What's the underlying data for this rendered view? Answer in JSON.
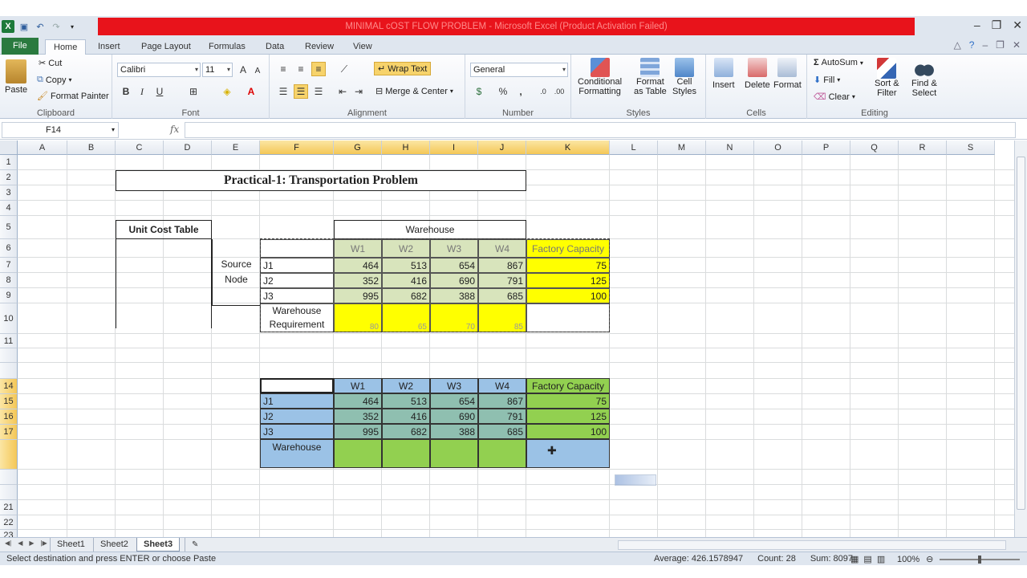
{
  "window": {
    "title": "MINIMAL cOST FLOW PROBLEM  -  Microsoft Excel (Product Activation Failed)"
  },
  "ribbon_tabs": [
    "File",
    "Home",
    "Insert",
    "Page Layout",
    "Formulas",
    "Data",
    "Review",
    "View"
  ],
  "clipboard": {
    "paste": "Paste",
    "cut": "Cut",
    "copy": "Copy",
    "format_painter": "Format Painter",
    "label": "Clipboard"
  },
  "font": {
    "name": "Calibri",
    "size": "11",
    "label": "Font"
  },
  "alignment": {
    "wrap_text": "Wrap Text",
    "merge_center": "Merge & Center",
    "label": "Alignment"
  },
  "number": {
    "format": "General",
    "label": "Number"
  },
  "styles": {
    "conditional": "Conditional",
    "conditional2": "Formatting",
    "format_as": "Format",
    "format_as2": "as Table",
    "cell": "Cell",
    "cell2": "Styles",
    "label": "Styles"
  },
  "cells": {
    "insert": "Insert",
    "delete": "Delete",
    "format": "Format",
    "label": "Cells"
  },
  "editing": {
    "autosum": "AutoSum",
    "fill": "Fill",
    "clear": "Clear",
    "sort": "Sort &",
    "sort2": "Filter",
    "find": "Find &",
    "find2": "Select",
    "label": "Editing"
  },
  "formula_bar": {
    "name_box": "F14",
    "fx": "fx",
    "value": ""
  },
  "columns": [
    "A",
    "B",
    "C",
    "D",
    "E",
    "F",
    "G",
    "H",
    "I",
    "J",
    "K",
    "L",
    "M",
    "N",
    "O",
    "P",
    "Q",
    "R",
    "S"
  ],
  "rows": [
    "1",
    "2",
    "3",
    "4",
    "5",
    "6",
    "7",
    "8",
    "9",
    "10",
    "11",
    "",
    "",
    "14",
    "15",
    "16",
    "17",
    "",
    "",
    "",
    "21",
    "22",
    "23"
  ],
  "sheet": {
    "title": "Practical-1: Transportation Problem",
    "unit_cost_table": "Unit Cost Table",
    "warehouse": "Warehouse",
    "source_node_1": "Source",
    "source_node_2": "Node",
    "table1": {
      "headers": [
        "W1",
        "W2",
        "W3",
        "W4",
        "Factory Capacity"
      ],
      "rows": [
        {
          "label": "J1",
          "values": [
            "464",
            "513",
            "654",
            "867"
          ],
          "capacity": "75"
        },
        {
          "label": "J2",
          "values": [
            "352",
            "416",
            "690",
            "791"
          ],
          "capacity": "125"
        },
        {
          "label": "J3",
          "values": [
            "995",
            "682",
            "388",
            "685"
          ],
          "capacity": "100"
        }
      ],
      "req_label_1": "Warehouse",
      "req_label_2": "Requirement",
      "requirements": [
        "80",
        "65",
        "70",
        "85"
      ]
    },
    "table2": {
      "headers": [
        "W1",
        "W2",
        "W3",
        "W4",
        "Factory Capacity"
      ],
      "rows": [
        {
          "label": "J1",
          "values": [
            "464",
            "513",
            "654",
            "867"
          ],
          "capacity": "75"
        },
        {
          "label": "J2",
          "values": [
            "352",
            "416",
            "690",
            "791"
          ],
          "capacity": "125"
        },
        {
          "label": "J3",
          "values": [
            "995",
            "682",
            "388",
            "685"
          ],
          "capacity": "100"
        }
      ],
      "req_label": "Warehouse"
    }
  },
  "sheet_tabs": [
    "Sheet1",
    "Sheet2",
    "Sheet3"
  ],
  "status": {
    "message": "Select destination and press ENTER or choose Paste",
    "average": "Average: 426.1578947",
    "count": "Count: 28",
    "sum": "Sum: 8097",
    "zoom": "100%"
  },
  "colors": {
    "green": "#d8e4bc",
    "yellow": "#ffff00",
    "blue": "#9bc2e6",
    "teal": "#8fbfb0",
    "lime": "#92d050"
  }
}
